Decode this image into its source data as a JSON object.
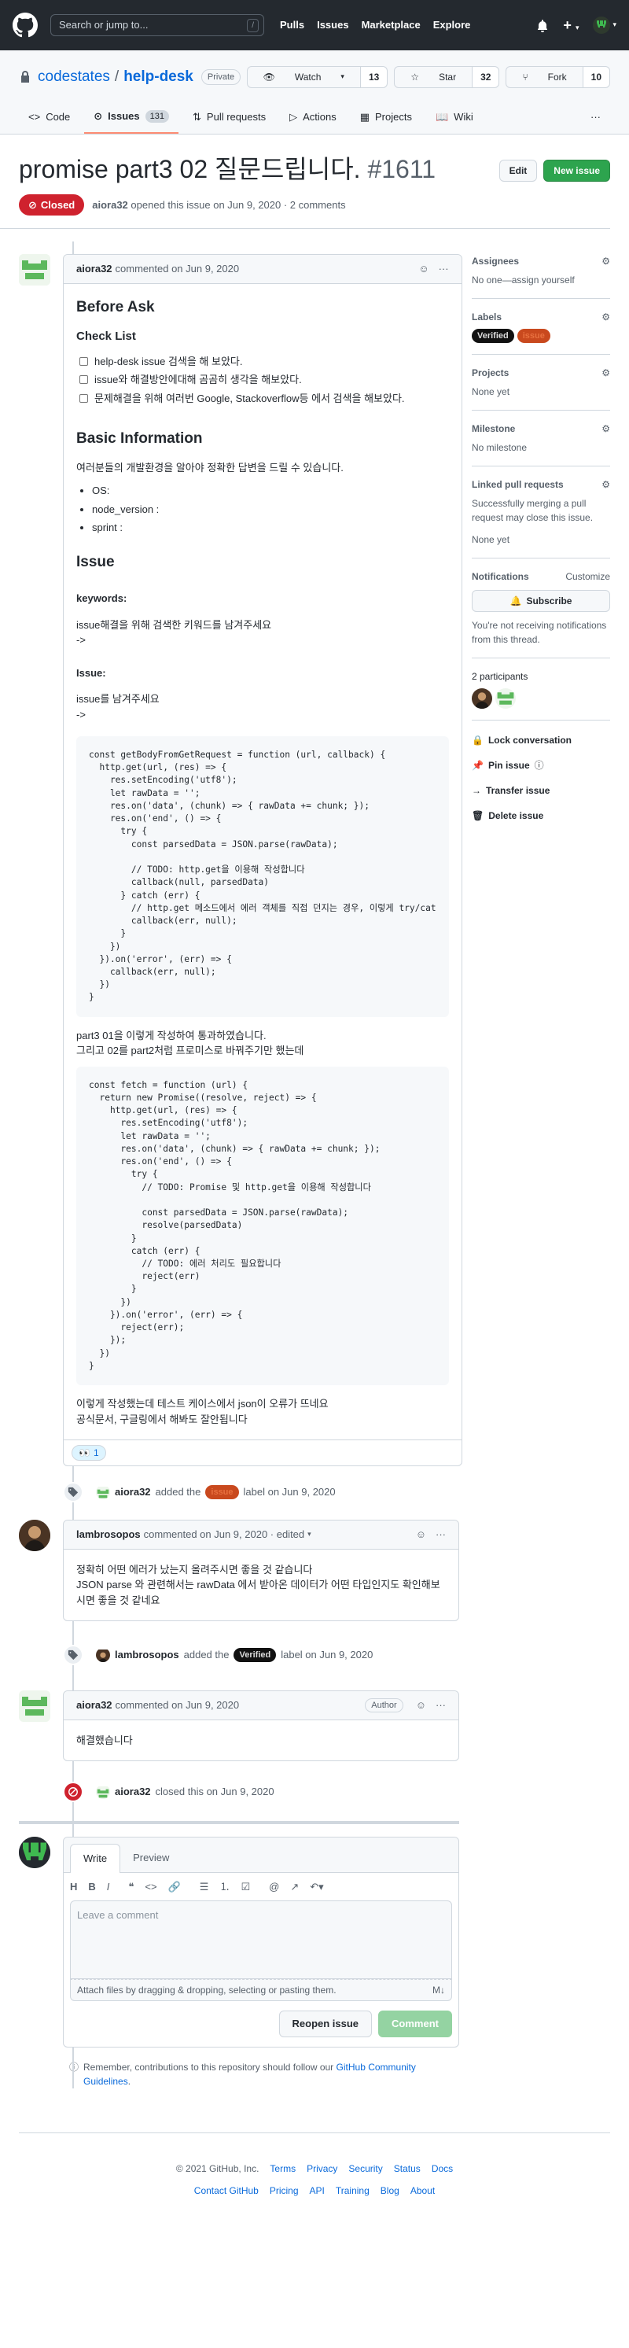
{
  "header": {
    "search_placeholder": "Search or jump to...",
    "search_key": "/",
    "nav": [
      "Pulls",
      "Issues",
      "Marketplace",
      "Explore"
    ]
  },
  "repo": {
    "owner": "codestates",
    "separator": "/",
    "name": "help-desk",
    "visibility": "Private",
    "watch_label": "Watch",
    "watch_count": "13",
    "star_label": "Star",
    "star_count": "32",
    "fork_label": "Fork",
    "fork_count": "10"
  },
  "tabs": {
    "code": "Code",
    "issues": "Issues",
    "issues_count": "131",
    "pulls": "Pull requests",
    "actions": "Actions",
    "projects": "Projects",
    "wiki": "Wiki"
  },
  "issue": {
    "title": "promise part3 02 질문드립니다.",
    "number": "#1611",
    "edit": "Edit",
    "new_issue": "New issue",
    "state": "Closed",
    "author": "aiora32",
    "opened_text": "opened this issue on Jun 9, 2020 · 2 comments"
  },
  "comment1": {
    "author": "aiora32",
    "meta": "commented on Jun 9, 2020",
    "h_before": "Before Ask",
    "h_checklist": "Check List",
    "tasks": [
      "help-desk issue 검색을 해 보았다.",
      "issue와 해결방안에대해 곰곰히 생각을 해보았다.",
      "문제해결을 위해 여러번 Google, Stackoverflow등 에서 검색을 해보았다."
    ],
    "h_basic": "Basic Information",
    "basic_text": "여러분들의 개발환경을 알아야 정확한 답변을 드릴 수 있습니다.",
    "env": [
      "OS:",
      "node_version :",
      "sprint :"
    ],
    "h_issue": "Issue",
    "h_keywords": "keywords:",
    "keywords_text": "issue해결을 위해 검색한 키워드를 남겨주세요",
    "arrow1": "->",
    "h_issue2": "Issue:",
    "issue_text": "issue를 남겨주세요",
    "arrow2": "->",
    "code1": "const getBodyFromGetRequest = function (url, callback) {\n  http.get(url, (res) => {\n    res.setEncoding('utf8');\n    let rawData = '';\n    res.on('data', (chunk) => { rawData += chunk; });\n    res.on('end', () => {\n      try {\n        const parsedData = JSON.parse(rawData);\n\n        // TODO: http.get을 이용해 작성합니다\n        callback(null, parsedData)\n      } catch (err) {\n        // http.get 메소드에서 에러 객체를 직접 던지는 경우, 이렇게 try/cat\n        callback(err, null);\n      }\n    })\n  }).on('error', (err) => {\n    callback(err, null);\n  })\n}",
    "mid1": "part3 01을 이렇게 작성하여 통과하였습니다.",
    "mid2": "그리고 02를 part2처럼 프로미스로 바꿔주기만 했는데",
    "code2": "const fetch = function (url) {\n  return new Promise((resolve, reject) => {\n    http.get(url, (res) => {\n      res.setEncoding('utf8');\n      let rawData = '';\n      res.on('data', (chunk) => { rawData += chunk; });\n      res.on('end', () => {\n        try {\n          // TODO: Promise 및 http.get을 이용해 작성합니다\n\n          const parsedData = JSON.parse(rawData);\n          resolve(parsedData)\n        }\n        catch (err) {\n          // TODO: 에러 처리도 필요합니다\n          reject(err)\n        }\n      })\n    }).on('error', (err) => {\n      reject(err);\n    });\n  })\n}",
    "end1": "이렇게 작성했는데 테스트 케이스에서 json이 오류가 뜨네요",
    "end2": "공식문서, 구글링에서 해봐도 잘안됩니다",
    "reaction_count": "1"
  },
  "event1": {
    "author": "aiora32",
    "pre": "added the",
    "label": "issue",
    "post": "label on Jun 9, 2020"
  },
  "comment2": {
    "author": "lambrosopos",
    "meta": "commented on Jun 9, 2020 · edited",
    "line1": "정확히 어떤 에러가 났는지 올려주시면 좋을 것 같습니다",
    "line2": "JSON parse 와 관련해서는 rawData 에서 받아온 데이터가 어떤 타입인지도 확인해보",
    "line3": "시면 좋을 것 같네요"
  },
  "event2": {
    "author": "lambrosopos",
    "pre": "added the",
    "label": "Verified",
    "post": "label on Jun 9, 2020"
  },
  "comment3": {
    "author": "aiora32",
    "meta": "commented on Jun 9, 2020",
    "badge": "Author",
    "body": "해결했습니다"
  },
  "event3": {
    "author": "aiora32",
    "text": "closed this on Jun 9, 2020"
  },
  "compose": {
    "tab_write": "Write",
    "tab_preview": "Preview",
    "placeholder": "Leave a comment",
    "attach": "Attach files by dragging & dropping, selecting or pasting them.",
    "reopen": "Reopen issue",
    "comment": "Comment"
  },
  "remember": {
    "text": "Remember, contributions to this repository should follow our",
    "link": "GitHub Community Guidelines",
    "dot": "."
  },
  "sidebar": {
    "assignees": "Assignees",
    "assignees_val": "No one—assign yourself",
    "labels": "Labels",
    "label1": "Verified",
    "label2": "issue",
    "projects": "Projects",
    "projects_val": "None yet",
    "milestone": "Milestone",
    "milestone_val": "No milestone",
    "linked": "Linked pull requests",
    "linked_val": "Successfully merging a pull request may close this issue.",
    "linked_none": "None yet",
    "notifications": "Notifications",
    "customize": "Customize",
    "subscribe": "Subscribe",
    "notif_text": "You're not receiving notifications from this thread.",
    "participants": "2 participants",
    "lock": "Lock conversation",
    "pin": "Pin issue",
    "transfer": "Transfer issue",
    "delete": "Delete issue"
  },
  "footer": {
    "copyright": "© 2021 GitHub, Inc.",
    "row1": [
      "Terms",
      "Privacy",
      "Security",
      "Status",
      "Docs"
    ],
    "row2": [
      "Contact GitHub",
      "Pricing",
      "API",
      "Training",
      "Blog",
      "About"
    ]
  },
  "colors": {
    "header_bg": "#24292f",
    "closed": "#cf222e",
    "green": "#2da44e",
    "link": "#0969da",
    "issue_label": "#c9491e",
    "verified_label": "#111111"
  }
}
